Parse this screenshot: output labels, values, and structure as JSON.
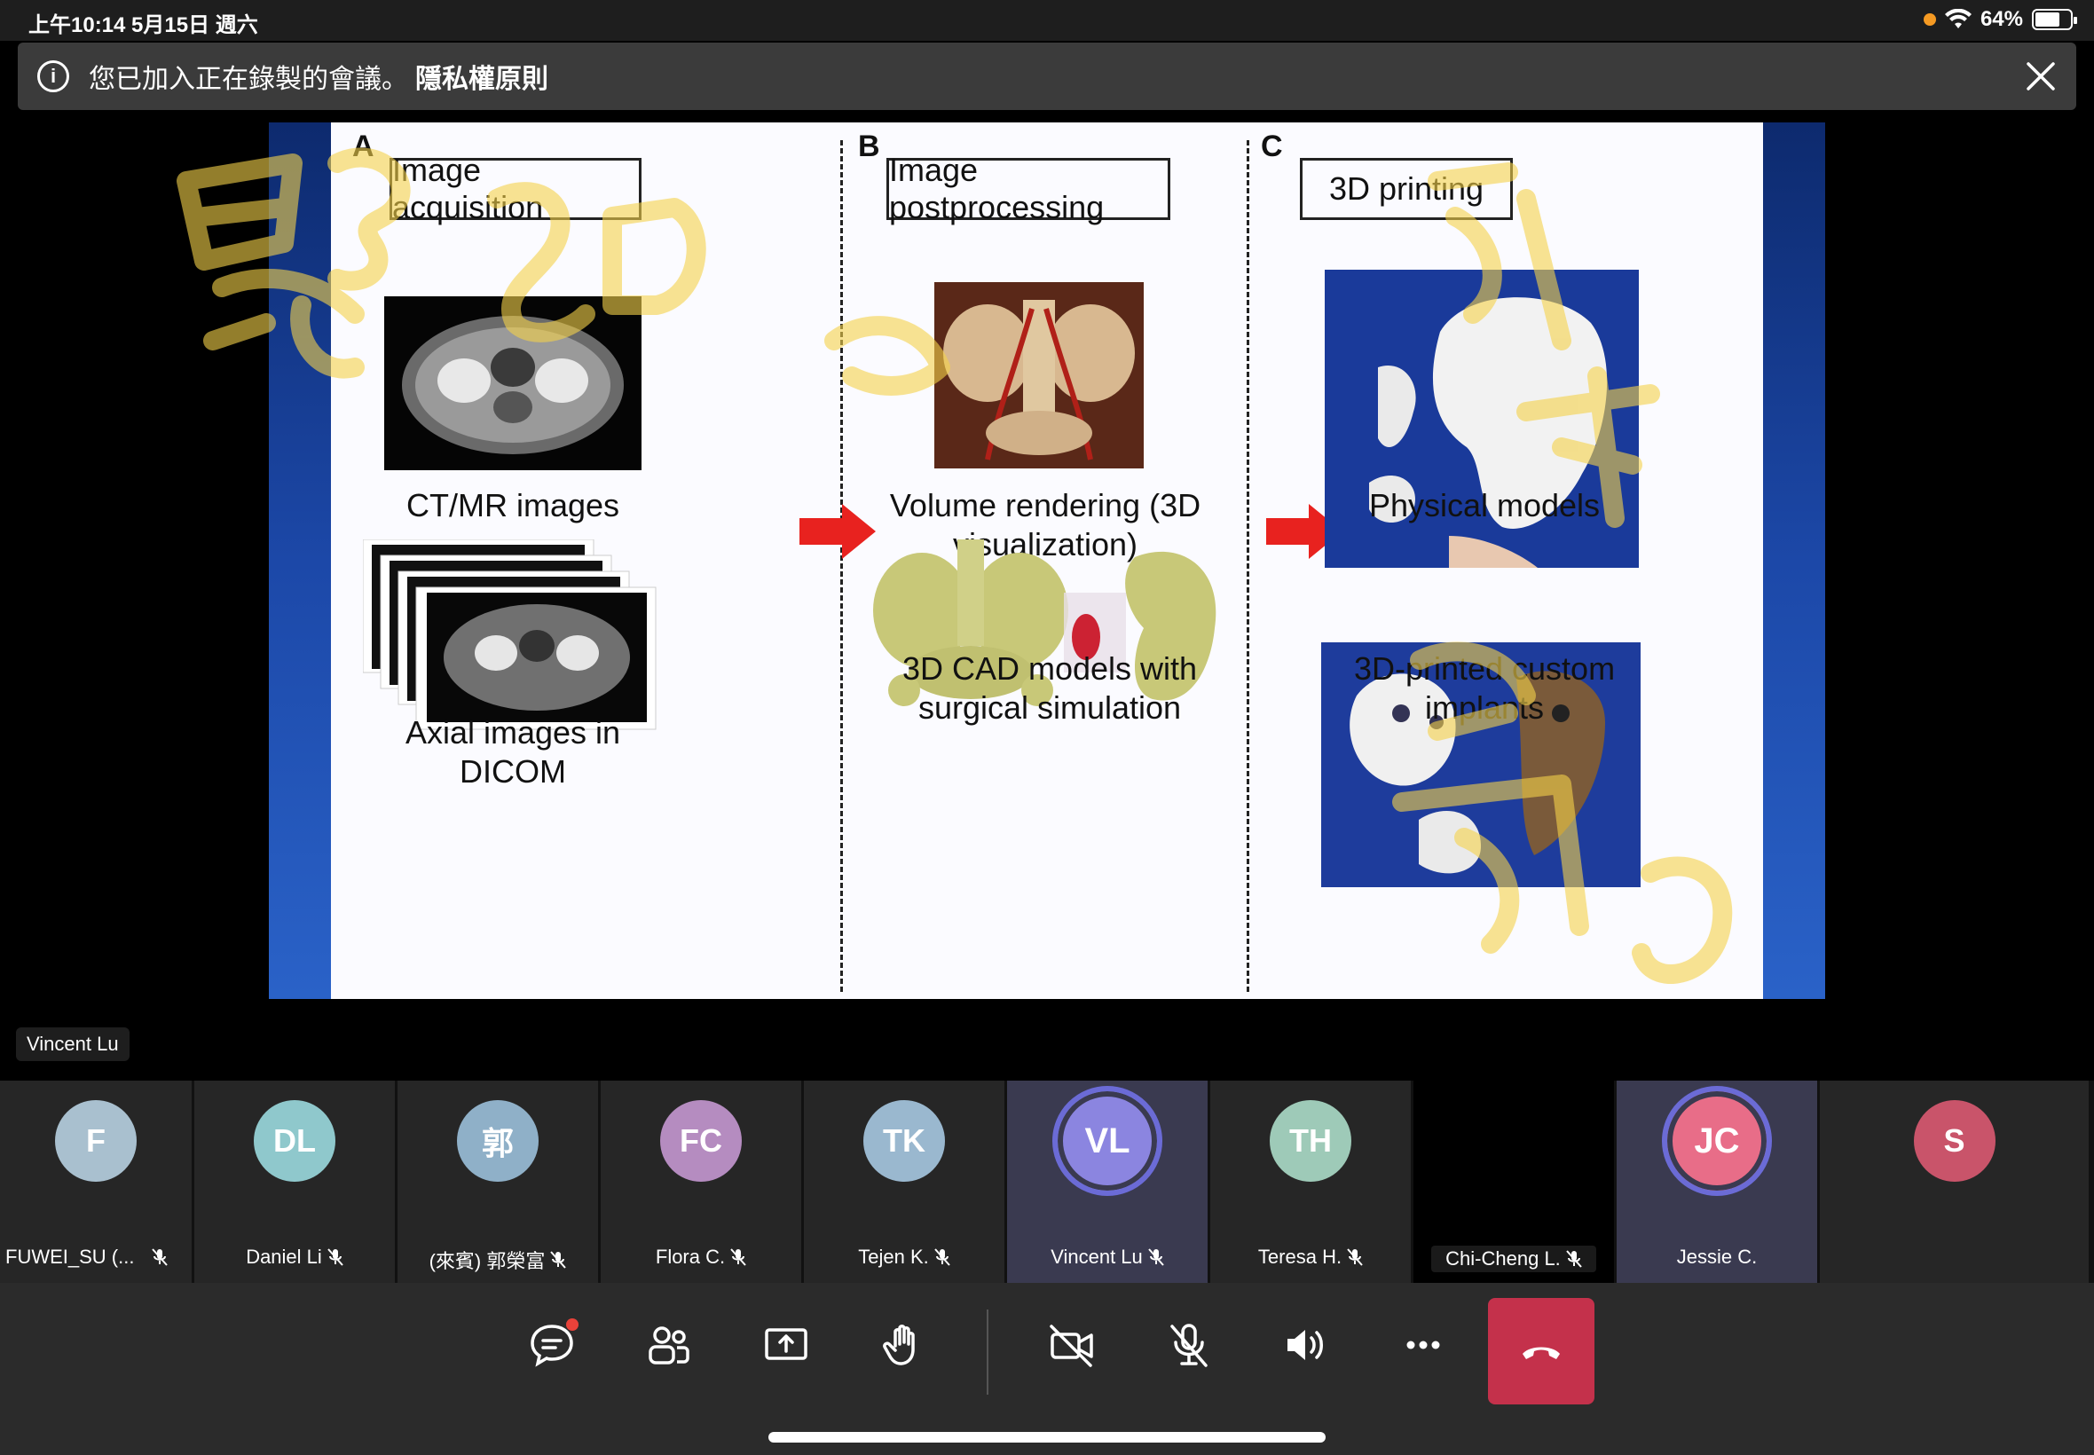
{
  "status_bar": {
    "time_date": "上午10:14   5月15日 週六",
    "battery": "64%",
    "battery_level": 0.64
  },
  "banner": {
    "text": "您已加入正在錄製的會議。",
    "link": "隱私權原則"
  },
  "slide": {
    "col_a": {
      "letter": "A",
      "title": "Image acquisition",
      "caption_top": "CT/MR images",
      "caption_bottom": "Axial images in DICOM"
    },
    "col_b": {
      "letter": "B",
      "title": "Image postprocessing",
      "caption_top": "Volume rendering (3D visualization)",
      "caption_bottom_1": "3D CAD models with",
      "caption_bottom_2": "surgical simulation"
    },
    "col_c": {
      "letter": "C",
      "title": "3D printing",
      "caption_top": "Physical models",
      "caption_bottom_1": "3D-printed custom",
      "caption_bottom_2": "implants"
    }
  },
  "speaker_label": "Vincent Lu",
  "participants": [
    {
      "initials": "F",
      "name": "FUWEI_SU (...",
      "color": "#a9c0cf",
      "muted": true
    },
    {
      "initials": "DL",
      "name": "Daniel Li",
      "color": "#8fc8cc",
      "muted": true
    },
    {
      "initials": "郭",
      "name": "(來賓) 郭榮富",
      "color": "#8fb0c8",
      "muted": true
    },
    {
      "initials": "FC",
      "name": "Flora C.",
      "color": "#b58cc0",
      "muted": true
    },
    {
      "initials": "TK",
      "name": "Tejen K.",
      "color": "#9ab8cf",
      "muted": true
    },
    {
      "initials": "VL",
      "name": "Vincent Lu",
      "color": "#8b85e0",
      "muted": true,
      "speaking": true
    },
    {
      "initials": "TH",
      "name": "Teresa H.",
      "color": "#9ecab8",
      "muted": true
    },
    {
      "initials": "",
      "name": "Chi-Cheng L.",
      "color": "#000000",
      "muted": true,
      "video": true
    },
    {
      "initials": "JC",
      "name": "Jessie C.",
      "color": "#e86d88",
      "muted": false,
      "speaking": true
    },
    {
      "initials": "S",
      "name": "",
      "color": "#c9546a",
      "muted": false
    }
  ],
  "controls": {
    "chat": "chat-icon",
    "participants": "people-icon",
    "share": "share-screen-icon",
    "raise_hand": "raise-hand-icon",
    "camera": "camera-off-icon",
    "mic": "mic-off-icon",
    "speaker": "speaker-icon",
    "more": "more-icon",
    "hangup": "hang-up-icon"
  }
}
